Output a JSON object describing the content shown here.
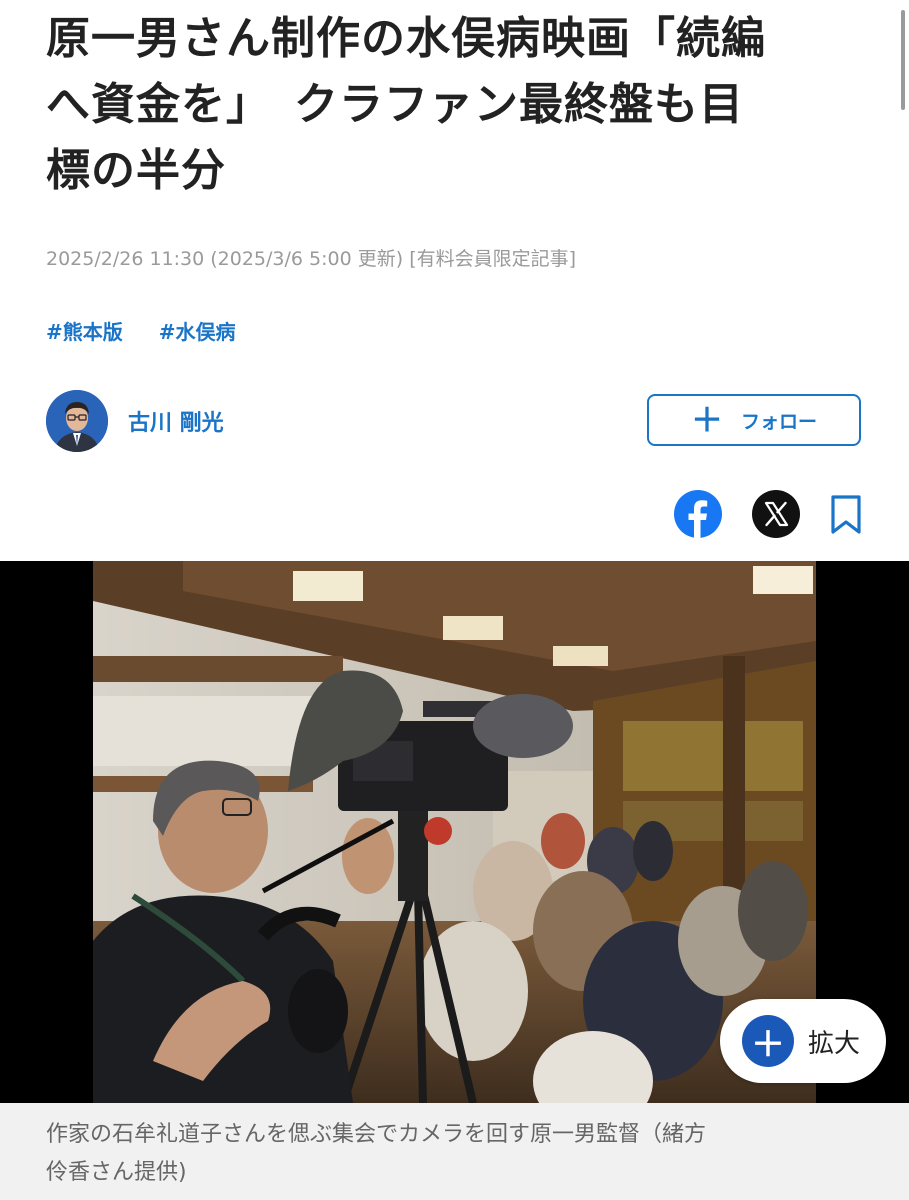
{
  "article": {
    "title_lines": [
      "原一男さん制作の水俣病映画「続編",
      "へ資金を」　クラファン最終盤も目",
      "標の半分"
    ],
    "dateline": "2025/2/26 11:30 (2025/3/6 5:00 更新) [有料会員限定記事]",
    "tags": [
      "#熊本版",
      "#水俣病"
    ]
  },
  "author": {
    "name": "古川 剛光",
    "follow_label": "フォロー",
    "follow_icon": "plus-icon"
  },
  "share": {
    "icons": [
      "facebook-icon",
      "x-icon",
      "bookmark-icon"
    ]
  },
  "photo": {
    "zoom_label": "拡大",
    "zoom_icon": "plus-icon",
    "caption_lines": [
      "作家の石牟礼道子さんを偲ぶ集会でカメラを回す原一男監督（緒方",
      "伶香さん提供)"
    ]
  },
  "colors": {
    "accent": "#1a74c8",
    "zoom_accent": "#1a59b8",
    "facebook": "#1877f2",
    "meta_text": "#9a9a9a"
  }
}
